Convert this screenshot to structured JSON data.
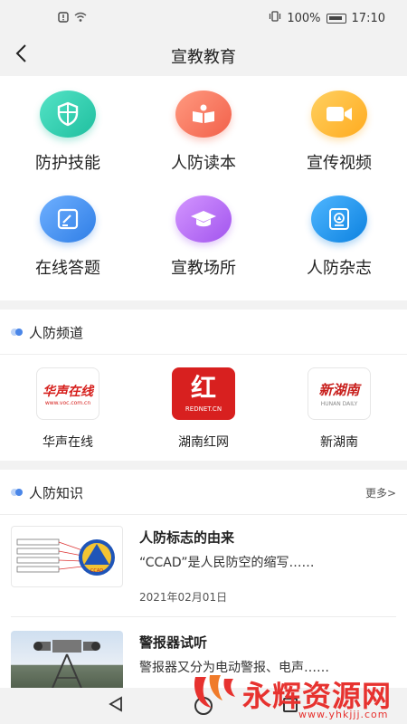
{
  "statusbar": {
    "battery": "100%",
    "time": "17:10"
  },
  "header": {
    "title": "宣教教育"
  },
  "grid": {
    "items": [
      {
        "label": "防护技能",
        "icon": "shield-icon",
        "color": "#2fd0b4"
      },
      {
        "label": "人防读本",
        "icon": "book-icon",
        "color": "#f7765e"
      },
      {
        "label": "宣传视频",
        "icon": "video-icon",
        "color": "#ffb733"
      },
      {
        "label": "在线答题",
        "icon": "edit-icon",
        "color": "#3d8ef0"
      },
      {
        "label": "宣教场所",
        "icon": "graduation-cap-icon",
        "color": "#b86cf2"
      },
      {
        "label": "人防杂志",
        "icon": "magazine-icon",
        "color": "#1a8fe8"
      }
    ]
  },
  "channels": {
    "title": "人防频道",
    "items": [
      {
        "label": "华声在线",
        "logo_text": "华声在线",
        "logo_sub": "www.voc.com.cn"
      },
      {
        "label": "湖南红网",
        "logo_text": "红",
        "logo_sub": "REDNET.CN"
      },
      {
        "label": "新湖南",
        "logo_text": "新湖南",
        "logo_sub": "HUNAN DAILY"
      }
    ]
  },
  "knowledge": {
    "title": "人防知识",
    "more": "更多>",
    "articles": [
      {
        "title": "人防标志的由来",
        "summary": "“CCAD”是人民防空的缩写……",
        "date": "2021年02月01日",
        "badge": "CCAD"
      },
      {
        "title": "警报器试听",
        "summary": "警报器又分为电动警报、电声……",
        "date": ""
      }
    ]
  },
  "watermark": {
    "text": "永辉资源网",
    "url": "www.yhkjjj.com"
  }
}
